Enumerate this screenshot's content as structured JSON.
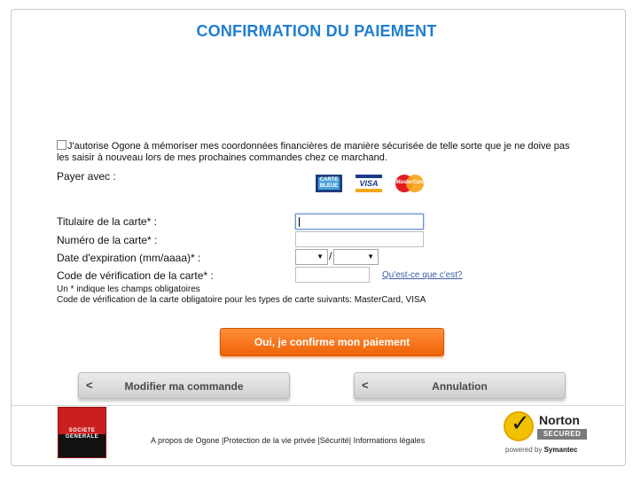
{
  "title": "CONFIRMATION DU PAIEMENT",
  "consent_text": "J'autorise Ogone à mémoriser mes coordonnées financières de manière sécurisée de telle sorte que je ne doive pas les saisir à nouveau lors de mes prochaines commandes chez ce marchand.",
  "consent_checked": false,
  "pay_with_label": "Payer avec :",
  "cards": {
    "carte_bleue_line1": "CARTE",
    "carte_bleue_line2": "BLEUE",
    "visa": "VISA",
    "mastercard": "MasterCard"
  },
  "form": {
    "holder_label": "Titulaire de la carte* :",
    "holder_value": "",
    "number_label": "Numéro de la carte* :",
    "number_value": "",
    "expiry_label": "Date d'expiration (mm/aaaa)* :",
    "expiry_month": "",
    "expiry_separator": "/",
    "expiry_year": "",
    "cvc_label": "Code de vérification de la carte* :",
    "cvc_value": "",
    "whats_this": "Qu'est-ce que c'est?"
  },
  "notes": {
    "required": "Un * indique les champs obligatoires",
    "cvc_required": "Code de vérification de la carte obligatoire pour les types de carte suivants: MasterCard, VISA"
  },
  "buttons": {
    "confirm": "Oui, je confirme mon paiement",
    "modify": "Modifier ma commande",
    "cancel": "Annulation",
    "chevron": "<"
  },
  "footer": {
    "bank_logo_line1": "SOCIETE",
    "bank_logo_line2": "GENERALE",
    "links": "A propos de Ogone |Protection de la vie privée |Sécurité| Informations légales",
    "norton_name": "Norton",
    "norton_secured": "SECURED",
    "norton_powered_prefix": "powered by ",
    "norton_powered_brand": "Symantec"
  },
  "colors": {
    "title": "#1f7fd0",
    "confirm_button": "#f07417",
    "link": "#3a5ea8"
  }
}
